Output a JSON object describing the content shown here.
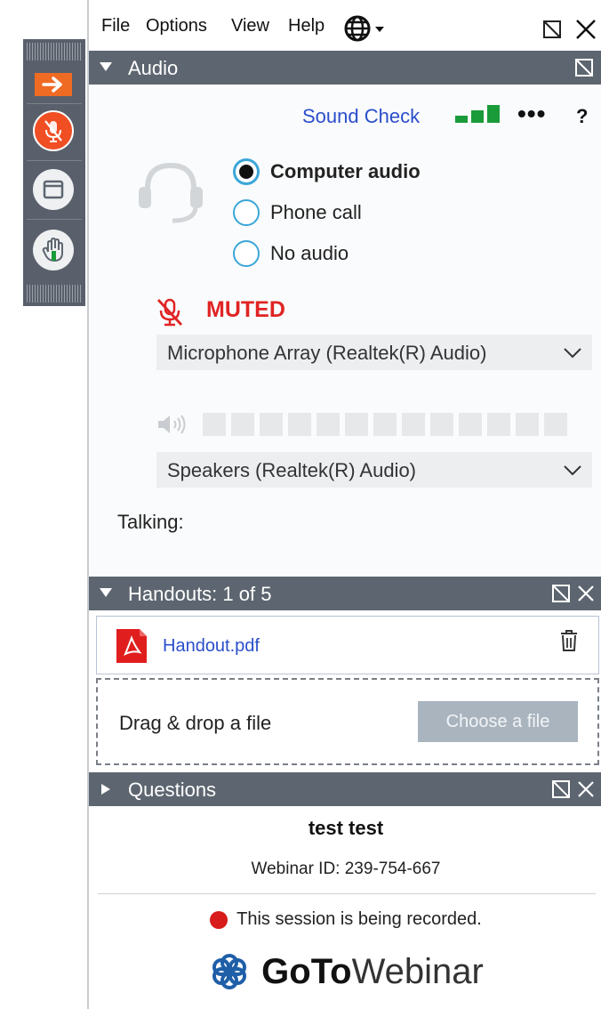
{
  "menubar": {
    "items": [
      "File",
      "Options",
      "View",
      "Help"
    ],
    "globe_icon": "globe-icon"
  },
  "audio": {
    "title": "Audio",
    "sound_check": "Sound Check",
    "more": "•••",
    "help": "?",
    "options": [
      {
        "label": "Computer audio",
        "selected": true
      },
      {
        "label": "Phone call",
        "selected": false
      },
      {
        "label": "No audio",
        "selected": false
      }
    ],
    "status": "MUTED",
    "microphone": "Microphone Array (Realtek(R) Audio)",
    "speakers": "Speakers (Realtek(R) Audio)",
    "speaker_level": 0,
    "talking_label": "Talking:"
  },
  "handouts": {
    "title": "Handouts: 1 of 5",
    "file_name": "Handout.pdf",
    "drop_text": "Drag & drop a file",
    "choose_button": "Choose a file"
  },
  "questions": {
    "title": "Questions"
  },
  "footer": {
    "webinar_title": "test test",
    "webinar_id": "Webinar ID: 239-754-667",
    "recording_text": "This session is being recorded.",
    "brand_bold": "GoTo",
    "brand_light": "Webinar"
  },
  "colors": {
    "header_bg": "#5d6670",
    "toolbar_bg": "#59606b",
    "accent_orange": "#ef6a22",
    "muted_red": "#e02424",
    "link_blue": "#2a4ecb",
    "radio_blue": "#3ba6d8",
    "level_green": "#1a9b3a",
    "brand_blue": "#1f5fa8"
  }
}
